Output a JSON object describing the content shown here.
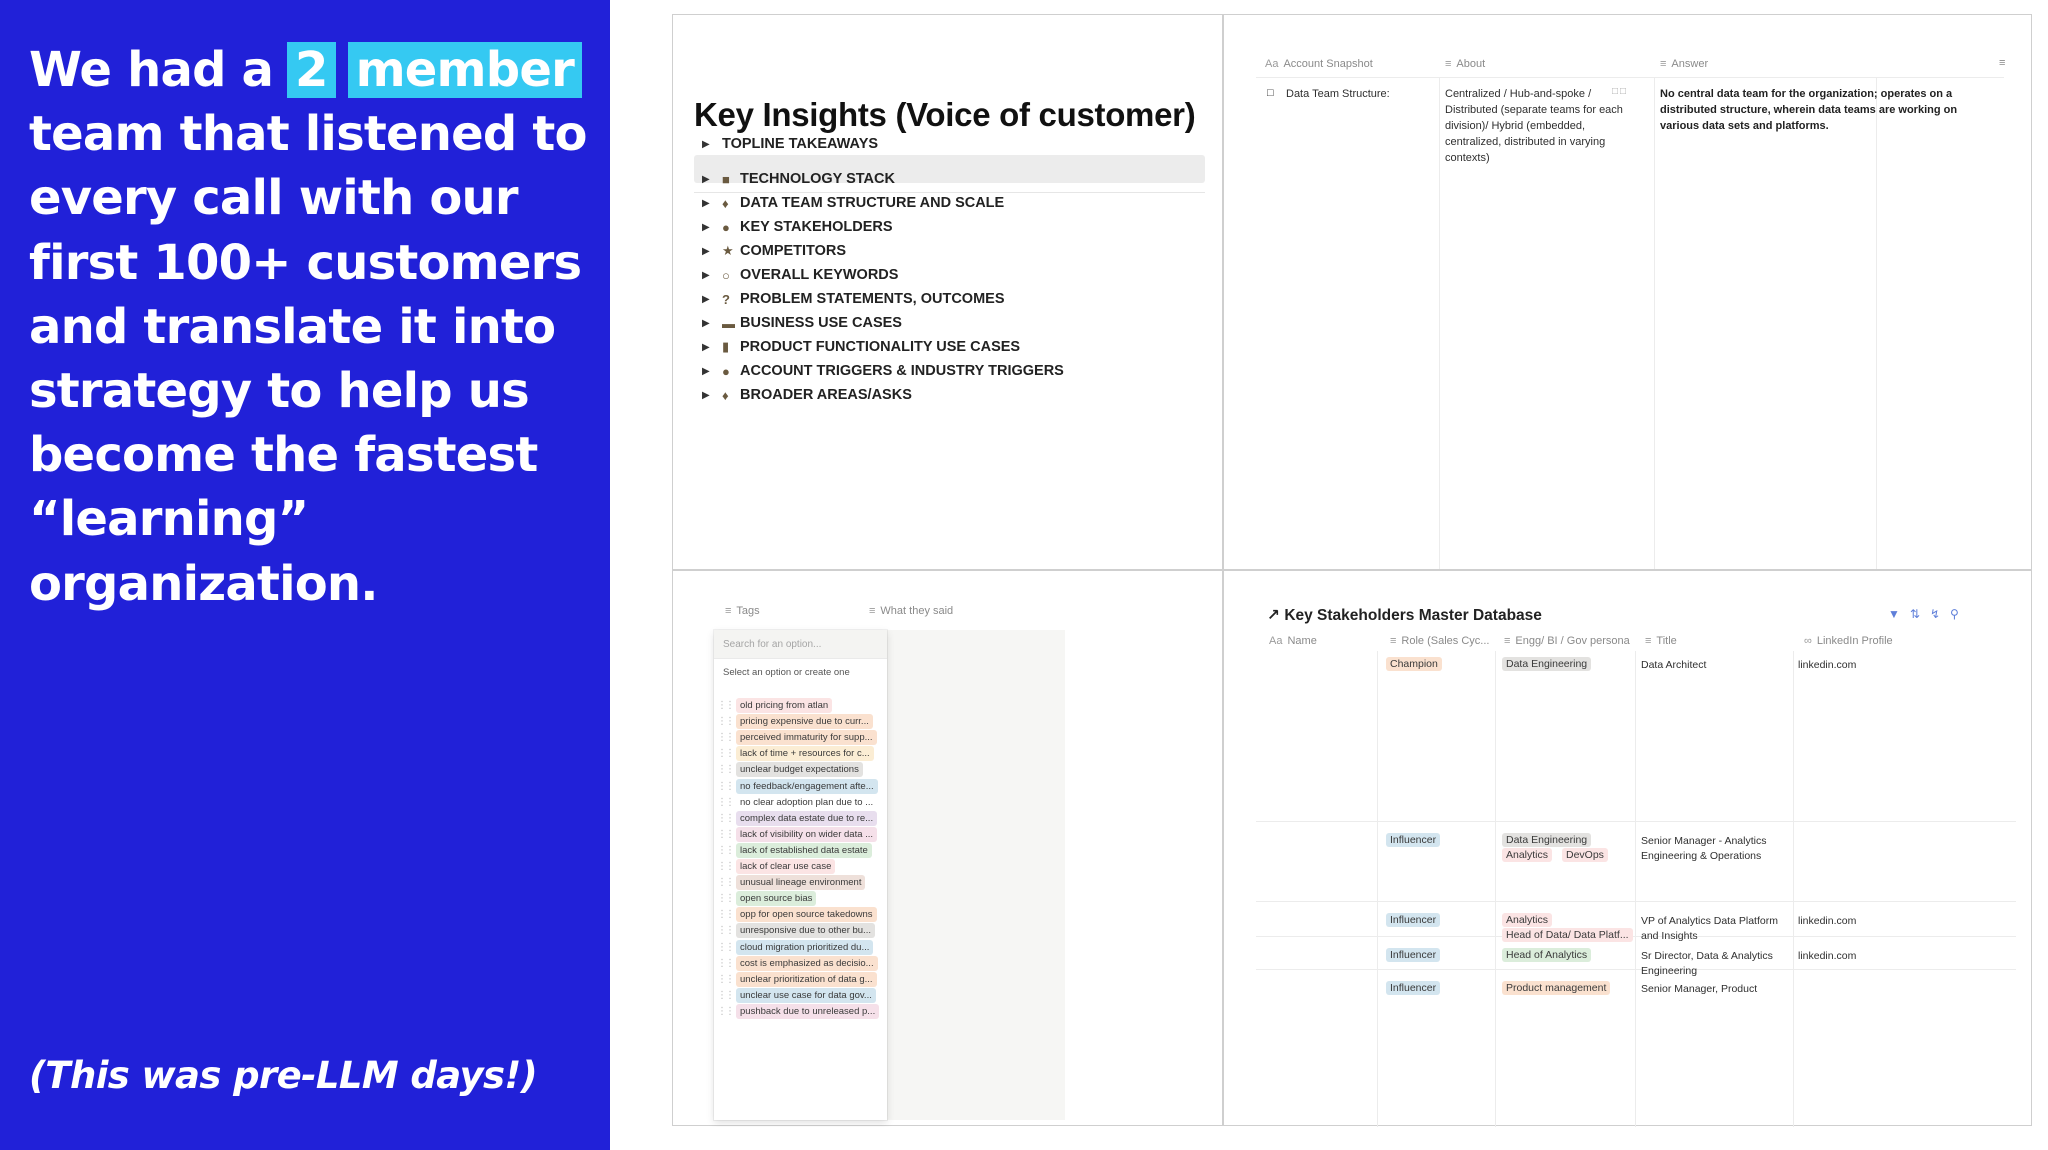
{
  "slide": {
    "headline_1": "We had a",
    "highlight_1": "2",
    "highlight_2": "member",
    "headline_2": "team that listened to every call with our first 100+ customers and translate it into strategy to help us become the fastest “learning” organization.",
    "footnote": "(This was pre-LLM days!)",
    "colors": {
      "background": "#2121d8",
      "highlight": "#35c9f2",
      "text": "#ffffff"
    }
  },
  "insights": {
    "title": "Key Insights (Voice of customer)",
    "toggles": [
      {
        "emoji_icon": "detective-icon",
        "icon": "◆",
        "label": "TOPLINE TAKEAWAYS"
      },
      {
        "emoji_icon": "detective-icon",
        "icon": "■",
        "label": "TECHNOLOGY STACK"
      },
      {
        "emoji_icon": "people-icon",
        "icon": "♦",
        "label": "DATA TEAM STRUCTURE AND SCALE"
      },
      {
        "emoji_icon": "person-icon",
        "icon": "●",
        "label": "KEY STAKEHOLDERS"
      },
      {
        "emoji_icon": "runner-icon",
        "icon": "★",
        "label": "COMPETITORS"
      },
      {
        "emoji_icon": "speech-bubble-icon",
        "icon": "○",
        "label": "OVERALL KEYWORDS"
      },
      {
        "emoji_icon": "question-mark-icon",
        "icon": "?",
        "label": "PROBLEM STATEMENTS, OUTCOMES"
      },
      {
        "emoji_icon": "card-icon",
        "icon": "▬",
        "label": "BUSINESS USE CASES"
      },
      {
        "emoji_icon": "phone-icon",
        "icon": "▮",
        "label": "PRODUCT FUNCTIONALITY USE CASES"
      },
      {
        "emoji_icon": "bomb-icon",
        "icon": "●",
        "label": "ACCOUNT TRIGGERS & INDUSTRY TRIGGERS"
      },
      {
        "emoji_icon": "person-raising-hand-icon",
        "icon": "♦",
        "label": "BROADER AREAS/ASKS"
      }
    ]
  },
  "snapshot": {
    "headers": {
      "name_icon": "Aa",
      "name": "Account Snapshot",
      "about": "About",
      "answer": "Answer"
    },
    "row": {
      "name": "Data Team Structure:",
      "about": "Centralized / Hub-and-spoke / Distributed (separate teams for each division)/ Hybrid (embedded, centralized, distributed in varying contexts)",
      "answer": "No central data team for the organization; operates on a distributed structure, wherein data teams are working on various data sets and platforms."
    }
  },
  "tags_menu": {
    "headers": {
      "tags": "Tags",
      "said": "What they said"
    },
    "search_placeholder": "Search for an option...",
    "hint": "Select an option or create one",
    "options": [
      {
        "label": "old pricing from atlan",
        "color": "red"
      },
      {
        "label": "pricing expensive due to curr...",
        "color": "orange"
      },
      {
        "label": "perceived immaturity for supp...",
        "color": "orange"
      },
      {
        "label": "lack of time + resources for c...",
        "color": "yellow"
      },
      {
        "label": "unclear budget expectations",
        "color": "gray"
      },
      {
        "label": "no feedback/engagement afte...",
        "color": "blue"
      },
      {
        "label": "no clear adoption plan due to ...",
        "color": "none"
      },
      {
        "label": "complex data estate due to re...",
        "color": "purple"
      },
      {
        "label": "lack of visibility on wider data ...",
        "color": "pink"
      },
      {
        "label": "lack of established data estate",
        "color": "green"
      },
      {
        "label": "lack of clear use case",
        "color": "red"
      },
      {
        "label": "unusual lineage environment",
        "color": "brown"
      },
      {
        "label": "open source bias",
        "color": "green"
      },
      {
        "label": "opp for open source takedowns",
        "color": "orange"
      },
      {
        "label": "unresponsive due to other bu...",
        "color": "gray"
      },
      {
        "label": "cloud migration prioritized du...",
        "color": "blue"
      },
      {
        "label": "cost is emphasized as decisio...",
        "color": "orange"
      },
      {
        "label": "unclear prioritization of data g...",
        "color": "orange"
      },
      {
        "label": "unclear use case for data gov...",
        "color": "blue"
      },
      {
        "label": "pushback due to unreleased p...",
        "color": "pink"
      }
    ]
  },
  "stakeholders": {
    "title": "Key Stakeholders Master Database",
    "title_icon": "↗",
    "headers": {
      "name": "Name",
      "role": "Role (Sales Cyc...",
      "persona": "Engg/ BI / Gov persona",
      "title": "Title",
      "linkedin": "LinkedIn Profile"
    },
    "rows": [
      {
        "role": "Champion",
        "role_color": "orange",
        "personas": [
          "Data Engineering"
        ],
        "title": "Data Architect",
        "linkedin": "linkedin.com"
      },
      {
        "role": "Influencer",
        "role_color": "blue",
        "personas": [
          "Data Engineering",
          "Analytics",
          "DevOps"
        ],
        "title": "Senior Manager - Analytics Engineering & Operations",
        "linkedin": ""
      },
      {
        "role": "Influencer",
        "role_color": "blue",
        "personas": [
          "Analytics",
          "Head of Data/ Data Platf..."
        ],
        "title": "VP of Analytics Data Platform and Insights",
        "linkedin": "linkedin.com"
      },
      {
        "role": "Influencer",
        "role_color": "blue",
        "personas": [
          "Head of Analytics"
        ],
        "title": "Sr Director, Data & Analytics Engineering",
        "linkedin": "linkedin.com"
      },
      {
        "role": "Influencer",
        "role_color": "blue",
        "personas": [
          "Product management"
        ],
        "title": "Senior Manager, Product",
        "linkedin": ""
      }
    ]
  }
}
